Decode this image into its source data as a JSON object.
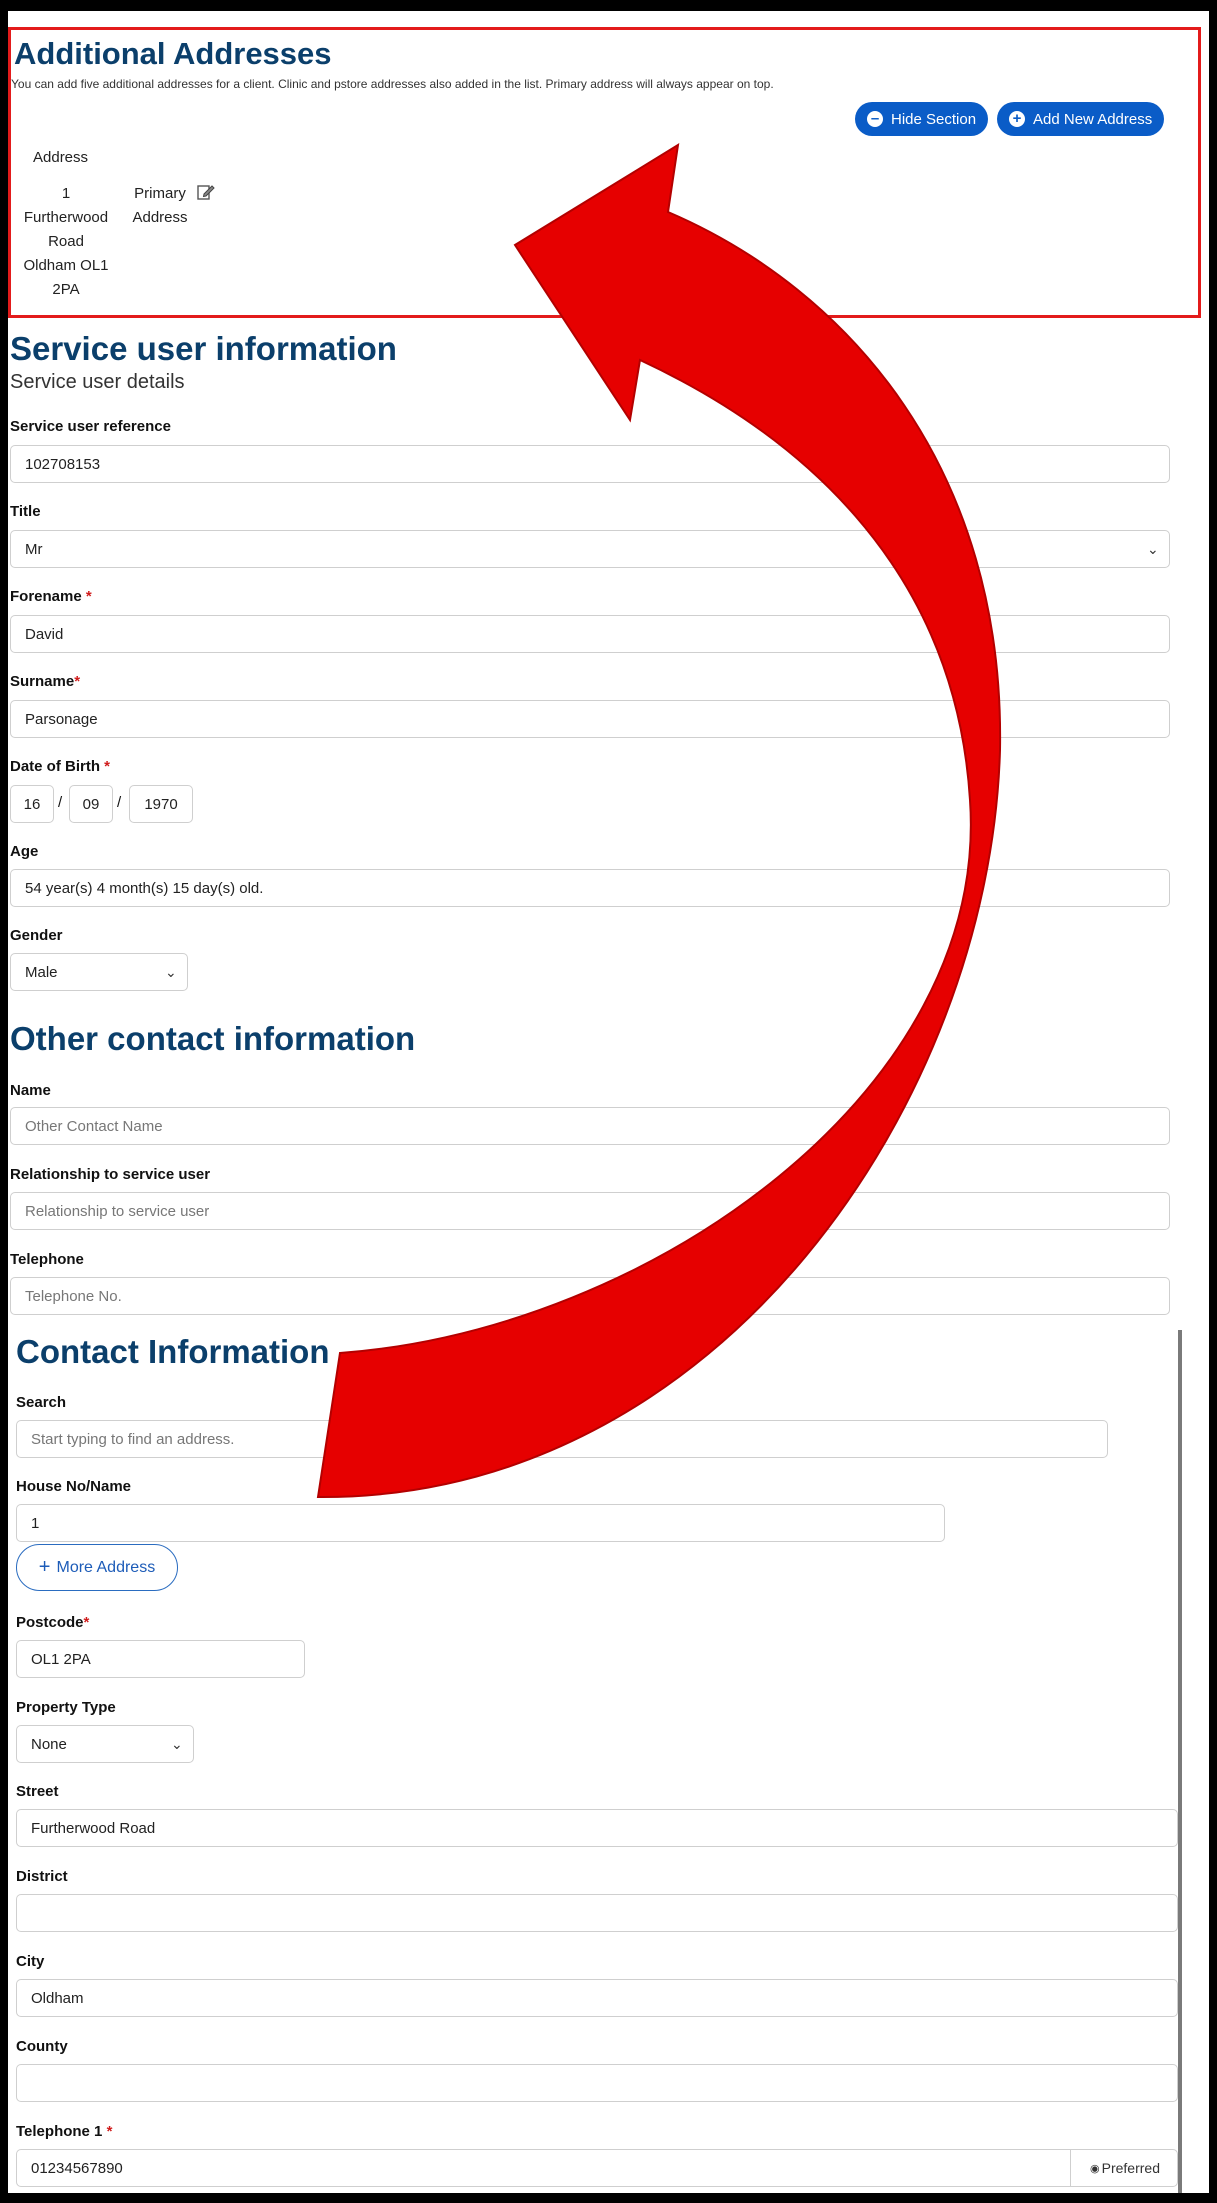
{
  "additional_addresses": {
    "title": "Additional Addresses",
    "description": "You can add five additional addresses for a client. Clinic and pstore addresses also added in the list. Primary address will always appear on top.",
    "hide_section_label": "Hide Section",
    "add_new_address_label": "Add New Address",
    "table_header": "Address",
    "rows": [
      {
        "address": "1\nFurtherwood\nRoad\nOldham OL1\n2PA",
        "type": "Primary\nAddress"
      }
    ]
  },
  "service_user": {
    "title": "Service user information",
    "subtitle": "Service user details",
    "reference_label": "Service user reference",
    "reference_value": "102708153",
    "title_label": "Title",
    "title_value": "Mr",
    "forename_label": "Forename ",
    "forename_value": "David",
    "surname_label": "Surname",
    "surname_value": "Parsonage",
    "dob_label": "Date of Birth ",
    "dob_day": "16",
    "dob_month": "09",
    "dob_year": "1970",
    "dob_sep": "/",
    "age_label": "Age",
    "age_value": "54 year(s) 4 month(s) 15 day(s) old.",
    "gender_label": "Gender",
    "gender_value": "Male",
    "required_mark": "*"
  },
  "other_contact": {
    "title": "Other contact information",
    "name_label": "Name",
    "name_placeholder": "Other Contact Name",
    "relationship_label": "Relationship to service user",
    "relationship_placeholder": "Relationship to service user",
    "telephone_label": "Telephone",
    "telephone_placeholder": "Telephone No."
  },
  "contact_info": {
    "title": "Contact Information",
    "search_label": "Search",
    "search_placeholder": "Start typing to find an address.",
    "house_label": "House No/Name",
    "house_value": "1",
    "more_address_label": "More Address",
    "postcode_label": "Postcode",
    "postcode_value": "OL1 2PA",
    "property_type_label": "Property Type",
    "property_type_value": "None",
    "street_label": "Street",
    "street_value": "Furtherwood Road",
    "district_label": "District",
    "district_value": "",
    "city_label": "City",
    "city_value": "Oldham",
    "county_label": "County",
    "county_value": "",
    "telephone1_label": "Telephone 1 ",
    "telephone1_value": "01234567890",
    "preferred_label": "Preferred"
  },
  "colors": {
    "heading": "#0b3f6b",
    "button": "#0a5cc7",
    "highlight_border": "#e31b1b",
    "arrow": "#e60000"
  }
}
